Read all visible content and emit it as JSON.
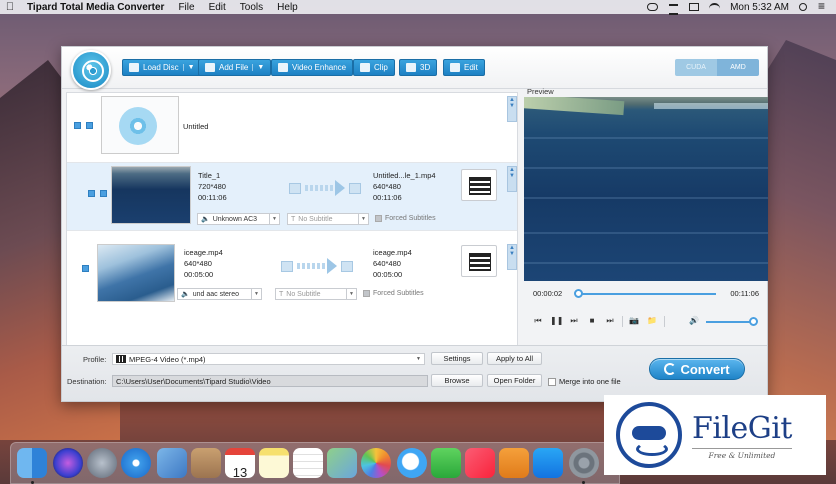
{
  "menubar": {
    "app_name": "Tipard Total Media Converter",
    "menus": [
      "File",
      "Edit",
      "Tools",
      "Help"
    ],
    "clock": "Mon 5:32 AM"
  },
  "toolbar": {
    "load_disc": "Load Disc",
    "add_file": "Add File",
    "video_enhance": "Video Enhance",
    "clip": "Clip",
    "three_d": "3D",
    "edit": "Edit",
    "gpu_cuda": "CUDA",
    "gpu_amd": "AMD"
  },
  "files": [
    {
      "title": "Untitled"
    },
    {
      "src_name": "Title_1",
      "src_res": "720*480",
      "src_dur": "00:11:06",
      "out_name": "Untitled...le_1.mp4",
      "out_res": "640*480",
      "out_dur": "00:11:06",
      "audio": "Unknown AC3",
      "subtitle": "No Subtitle",
      "forced": "Forced Subtitles"
    },
    {
      "src_name": "iceage.mp4",
      "src_res": "640*480",
      "src_dur": "00:05:00",
      "out_name": "iceage.mp4",
      "out_res": "640*480",
      "out_dur": "00:05:00",
      "audio": "und aac stereo",
      "subtitle": "No Subtitle",
      "forced": "Forced Subtitles"
    }
  ],
  "preview": {
    "label": "Preview",
    "current_time": "00:00:02",
    "total_time": "00:11:06",
    "progress": 0.003
  },
  "bottom": {
    "profile_label": "Profile:",
    "profile_value": "MPEG-4 Video (*.mp4)",
    "settings": "Settings",
    "apply_all": "Apply to All",
    "destination_label": "Destination:",
    "destination_value": "C:\\Users\\User\\Documents\\Tipard Studio\\Video",
    "browse": "Browse",
    "open_folder": "Open Folder",
    "merge": "Merge into one file",
    "convert": "Convert"
  },
  "dock": {
    "apps": [
      "finder",
      "siri",
      "launchpad",
      "safari",
      "photos-app",
      "notes-book",
      "calendar",
      "notes",
      "reminders",
      "maps",
      "photos",
      "messages",
      "facetime",
      "music",
      "books",
      "app-store",
      "system-preferences"
    ],
    "calendar_day": "13"
  },
  "watermark": {
    "title": "FileGit",
    "subtitle": "Free & Unlimited"
  }
}
